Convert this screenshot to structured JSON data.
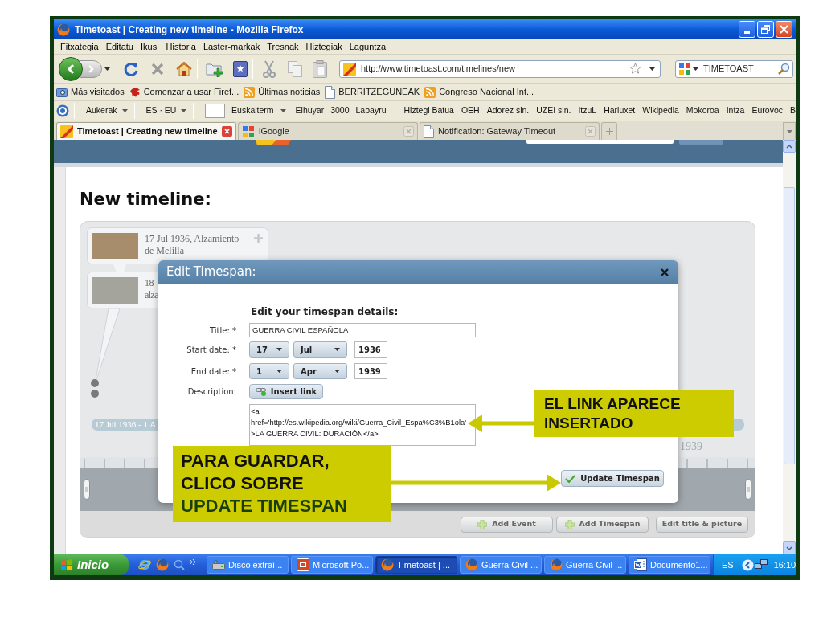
{
  "window": {
    "title": "Timetoast | Creating new timeline - Mozilla Firefox"
  },
  "menu_bar": [
    "Fitxategia",
    "Editatu",
    "Ikusi",
    "Historia",
    "Laster-markak",
    "Tresnak",
    "Hiztegiak",
    "Laguntza"
  ],
  "toolbar": {
    "address": "http://www.timetoast.com/timelines/new",
    "search": "TIMETOAST"
  },
  "bookmarks": [
    {
      "label": "Más visitados",
      "kind": "smart"
    },
    {
      "label": "Comenzar a usar Firef...",
      "kind": "start"
    },
    {
      "label": "Últimas noticias",
      "kind": "feed"
    },
    {
      "label": "BERRITZEGUNEAK",
      "kind": "page"
    },
    {
      "label": "Congreso Nacional Int...",
      "kind": "feed"
    }
  ],
  "dictionary_bar": {
    "menus": [
      "Aukerak",
      "ES · EU"
    ],
    "dictionaries": [
      {
        "label": "Euskalterm",
        "dropdown": true
      },
      {
        "label": "Elhuyar",
        "dropdown": false
      },
      {
        "label": "3000",
        "dropdown": false
      },
      {
        "label": "Labayru",
        "dropdown": false
      }
    ],
    "links": [
      "Hiztegi Batua",
      "OEH",
      "Adorez sin.",
      "UZEI sin.",
      "ItzuL",
      "Harluxet",
      "Wikipedia",
      "Mokoroa",
      "Intza",
      "Eurovoc",
      "B"
    ]
  },
  "tabs": [
    {
      "label": "Timetoast | Creating new timeline",
      "selected": true,
      "kind": "timetoast"
    },
    {
      "label": "iGoogle",
      "selected": false,
      "kind": "google"
    },
    {
      "label": "Notification: Gateway Timeout",
      "selected": false,
      "kind": "page"
    }
  ],
  "page": {
    "heading": "New timeline:",
    "events": [
      {
        "lines": [
          "17 Jul 1936, Alzamiento",
          "de Melilla"
        ],
        "kind": "full"
      },
      {
        "lines": [
          "18",
          "alza"
        ],
        "kind": "covered"
      }
    ],
    "timespan_label": "17 Jul 1936 - 1 A",
    "year_label": "1939",
    "buttons": [
      {
        "label": "Add Event",
        "kind": "add"
      },
      {
        "label": "Add Timespan",
        "kind": "add"
      },
      {
        "label": "Edit title & picture",
        "kind": "edit"
      }
    ]
  },
  "dialog": {
    "title": "Edit Timespan:",
    "heading": "Edit your timespan details:",
    "title_field": {
      "label": "Title: *",
      "value": "GUERRA CIVIL ESPAÑOLA"
    },
    "start_date": {
      "label": "Start date: *",
      "day": "17",
      "month": "Jul",
      "year": "1936"
    },
    "end_date": {
      "label": "End date: *",
      "day": "1",
      "month": "Apr",
      "year": "1939"
    },
    "description": {
      "label": "Description:",
      "button": "Insert link",
      "value": "<a href='http://es.wikipedia.org/wiki/Guerra_Civil_Espa%C3%B1ola' >LA GUERRA CIVIL: DURACIÓN</a>"
    },
    "submit": "Update Timespan"
  },
  "callouts": [
    {
      "text": "EL LINK APARECE INSERTADO"
    },
    {
      "text": "PARA GUARDAR, CLICO SOBRE",
      "emphasis": "UPDATE TIMESPAN"
    }
  ],
  "taskbar": {
    "start": "Inicio",
    "tasks": [
      {
        "label": "Disco extraí...",
        "selected": false,
        "kind": "drive"
      },
      {
        "label": "Microsoft Po...",
        "selected": false,
        "kind": "slides"
      },
      {
        "label": "Timetoast | ...",
        "selected": true,
        "kind": "firefox"
      },
      {
        "label": "Guerra Civil ...",
        "selected": false,
        "kind": "firefox"
      },
      {
        "label": "Guerra Civil ...",
        "selected": false,
        "kind": "firefox"
      },
      {
        "label": "Documento1...",
        "selected": false,
        "kind": "word"
      }
    ],
    "language": "ES",
    "clock": "16:10"
  }
}
